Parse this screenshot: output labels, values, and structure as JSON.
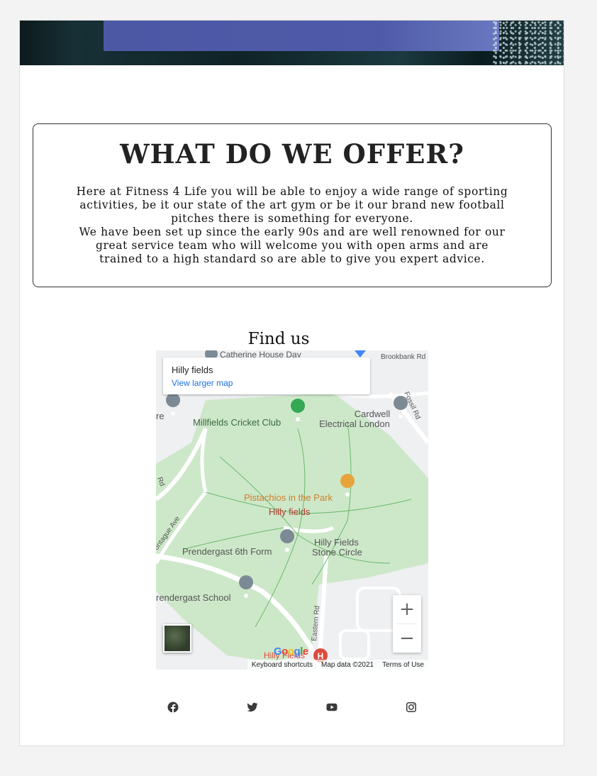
{
  "offer": {
    "title": "WHAT DO WE OFFER?",
    "paragraph1": "Here at Fitness 4 Life you will be able to enjoy a wide range of sporting activities, be it our state of the art gym or be it our brand new football pitches there is something for everyone.",
    "paragraph2": "We have been set up since the early 90s and are well renowned for our great service team who will welcome you with open arms and are trained to a high standard so are able to give you expert advice."
  },
  "find_us": {
    "title": "Find us",
    "map": {
      "place_name": "Hilly fields",
      "larger_map_link": "View larger map",
      "labels": {
        "catherine_house": "Catherine House Day",
        "brookbank": "Brookbank Rd",
        "fossil": "Fossil Rd",
        "millfields": "Millfields Cricket Club",
        "cardwell_1": "Cardwell",
        "cardwell_2": "Electrical London",
        "left_re": "re",
        "rd_left": "Rd",
        "pistachios": "Pistachios in the Park",
        "hilly_fields": "Hilly fields",
        "montague": "ontague Ave",
        "prendergast_6th": "Prendergast 6th Form",
        "stone_circle_1": "Hilly Fields",
        "stone_circle_2": "Stone Circle",
        "prendergast_school": "rendergast School",
        "eastern_rd": "Eastern Rd",
        "hilly_fields_bottom": "Hilly Fields"
      },
      "zoom_in": "+",
      "zoom_out": "−",
      "footer": {
        "keyboard": "Keyboard shortcuts",
        "map_data": "Map data ©2021",
        "terms": "Terms of Use"
      },
      "google_letters": [
        "G",
        "o",
        "o",
        "g",
        "l",
        "e"
      ]
    }
  },
  "social": [
    {
      "name": "facebook-icon"
    },
    {
      "name": "twitter-icon"
    },
    {
      "name": "youtube-icon"
    },
    {
      "name": "instagram-icon"
    }
  ],
  "colors": {
    "park_green": "#cde8c9",
    "park_path": "#6cb86e",
    "hero_band": "#4f5ba8",
    "restaurant": "#e8a33b",
    "hospital": "#dd4b3e"
  }
}
